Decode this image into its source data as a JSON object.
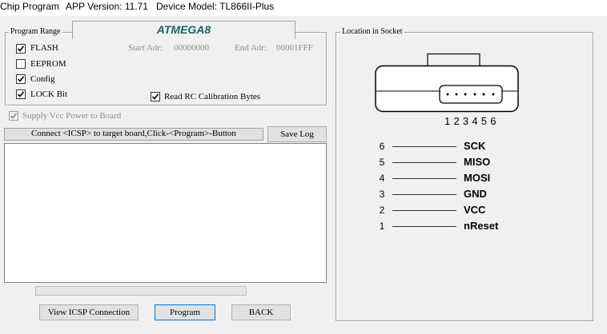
{
  "window": {
    "title": "Chip Program",
    "app_version": "APP Version: 11.71",
    "device_model": "Device Model: TL866II-Plus"
  },
  "program_range": {
    "legend": "Program Range",
    "chip_name": "ATMEGA8",
    "options": [
      {
        "label": "FLASH",
        "checked": true
      },
      {
        "label": "EEPROM",
        "checked": false
      },
      {
        "label": "Config",
        "checked": true
      },
      {
        "label": "LOCK Bit",
        "checked": true
      }
    ],
    "start_adr_label": "Start Adr:",
    "start_adr_value": "00000000",
    "end_adr_label": "End Adr:",
    "end_adr_value": "00001FFF",
    "rc_calibration": {
      "label": "Read RC Calibration Bytes",
      "checked": true
    }
  },
  "supply_vcc": {
    "label": "Supply Vcc Power to Board",
    "checked": true,
    "disabled": true
  },
  "status_message": "Connect <ICSP> to target board,Click-<Program>-Button",
  "save_log_label": "Save Log",
  "log_text": "",
  "progress": 0,
  "buttons": {
    "view_icsp": "View ICSP Connection",
    "program": "Program",
    "back": "BACK"
  },
  "socket": {
    "legend": "Location in Socket",
    "pin_numbers": "1 2 3 4 5 6",
    "pins": [
      {
        "num": "6",
        "name": "SCK"
      },
      {
        "num": "5",
        "name": "MISO"
      },
      {
        "num": "4",
        "name": "MOSI"
      },
      {
        "num": "3",
        "name": "GND"
      },
      {
        "num": "2",
        "name": "VCC"
      },
      {
        "num": "1",
        "name": "nReset"
      }
    ]
  }
}
